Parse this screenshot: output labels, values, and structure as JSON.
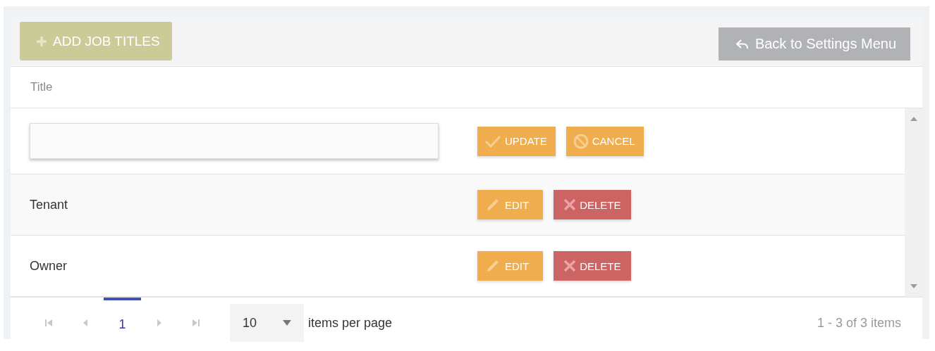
{
  "toolbar": {
    "add_button": {
      "label": "ADD JOB TITLES",
      "disabled": true
    },
    "back_button": {
      "label": "Back to Settings Menu"
    }
  },
  "table": {
    "columns": [
      "Title"
    ],
    "rows": [
      {
        "kind": "editing",
        "actions": [
          {
            "kind": "update",
            "label": "UPDATE"
          },
          {
            "kind": "cancel",
            "label": "CANCEL"
          }
        ]
      },
      {
        "kind": "view",
        "title": "Tenant",
        "actions": [
          {
            "kind": "edit",
            "label": "EDIT"
          },
          {
            "kind": "delete",
            "label": "DELETE"
          }
        ]
      },
      {
        "kind": "view",
        "title": "Owner",
        "actions": [
          {
            "kind": "edit",
            "label": "EDIT"
          },
          {
            "kind": "delete",
            "label": "DELETE"
          }
        ]
      }
    ]
  },
  "pager": {
    "nav": [
      {
        "kind": "first",
        "disabled": true
      },
      {
        "kind": "prev",
        "disabled": true
      },
      {
        "kind": "page",
        "label": "1",
        "selected": true
      },
      {
        "kind": "next",
        "disabled": true
      },
      {
        "kind": "last",
        "disabled": true
      }
    ],
    "page_size": "10",
    "page_size_label": "items per page",
    "summary": "1 - 3 of 3 items"
  }
}
